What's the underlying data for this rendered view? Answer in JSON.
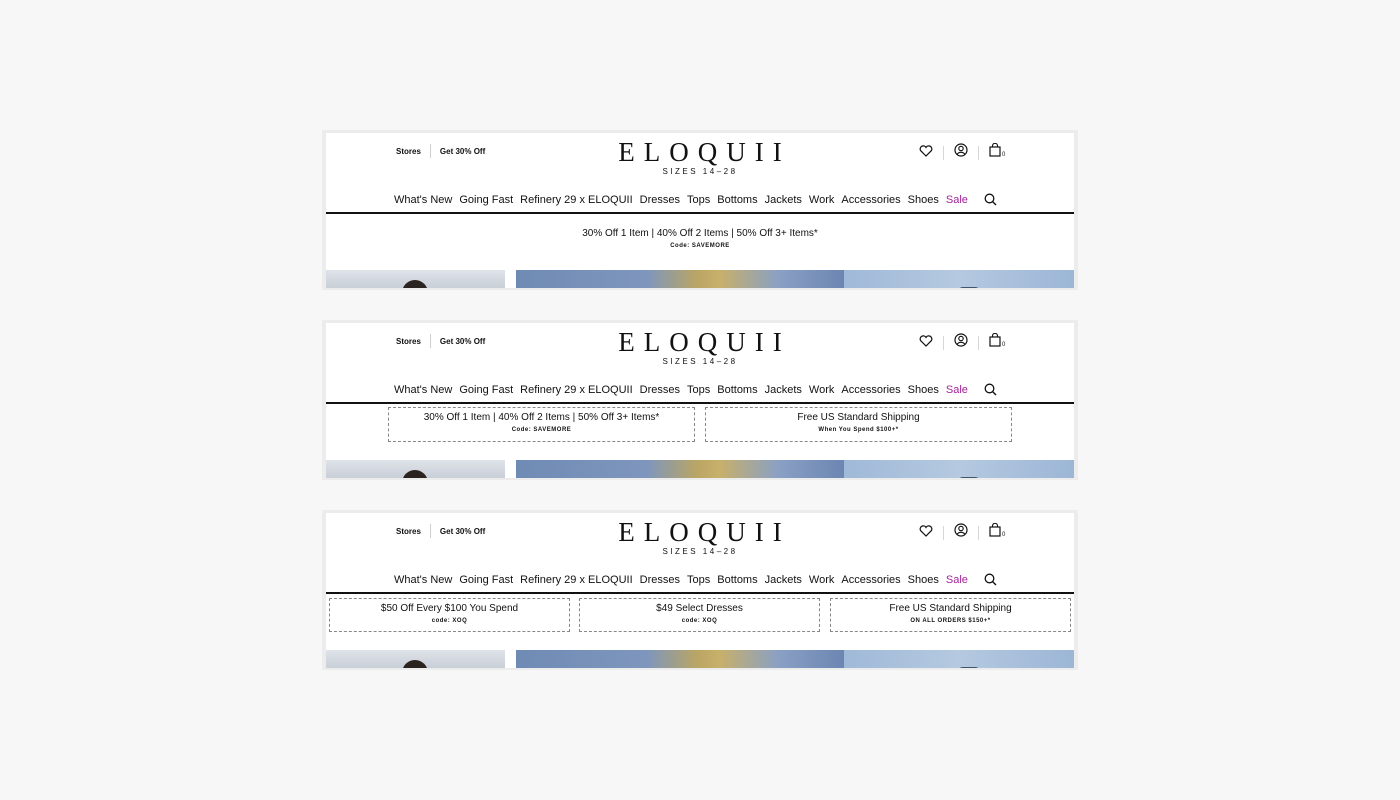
{
  "header": {
    "stores_label": "Stores",
    "offer_link": "Get 30% Off",
    "logo": "ELOQUII",
    "tagline": "SIZES 14–28",
    "cart_count": "0"
  },
  "nav": {
    "items": [
      "What's New",
      "Going Fast",
      "Refinery 29 x ELOQUII",
      "Dresses",
      "Tops",
      "Bottoms",
      "Jackets",
      "Work",
      "Accessories",
      "Shoes"
    ],
    "sale": "Sale",
    "sale_color": "#a3239a"
  },
  "variants": [
    {
      "promos": [
        {
          "main": "30% Off 1 Item | 40% Off 2 Items | 50% Off 3+ Items*",
          "sub": "Code: SAVEMORE"
        }
      ]
    },
    {
      "promos": [
        {
          "main": "30% Off 1 Item | 40% Off 2 Items | 50% Off 3+ Items*",
          "sub": "Code: SAVEMORE"
        },
        {
          "main": "Free US Standard Shipping",
          "sub": "When You Spend $100+*"
        }
      ]
    },
    {
      "promos": [
        {
          "main": "$50 Off Every $100 You Spend",
          "sub": "code: XOQ"
        },
        {
          "main": "$49 Select Dresses",
          "sub": "code: XOQ"
        },
        {
          "main": "Free US Standard Shipping",
          "sub": "ON ALL ORDERS $150+*"
        }
      ]
    }
  ]
}
